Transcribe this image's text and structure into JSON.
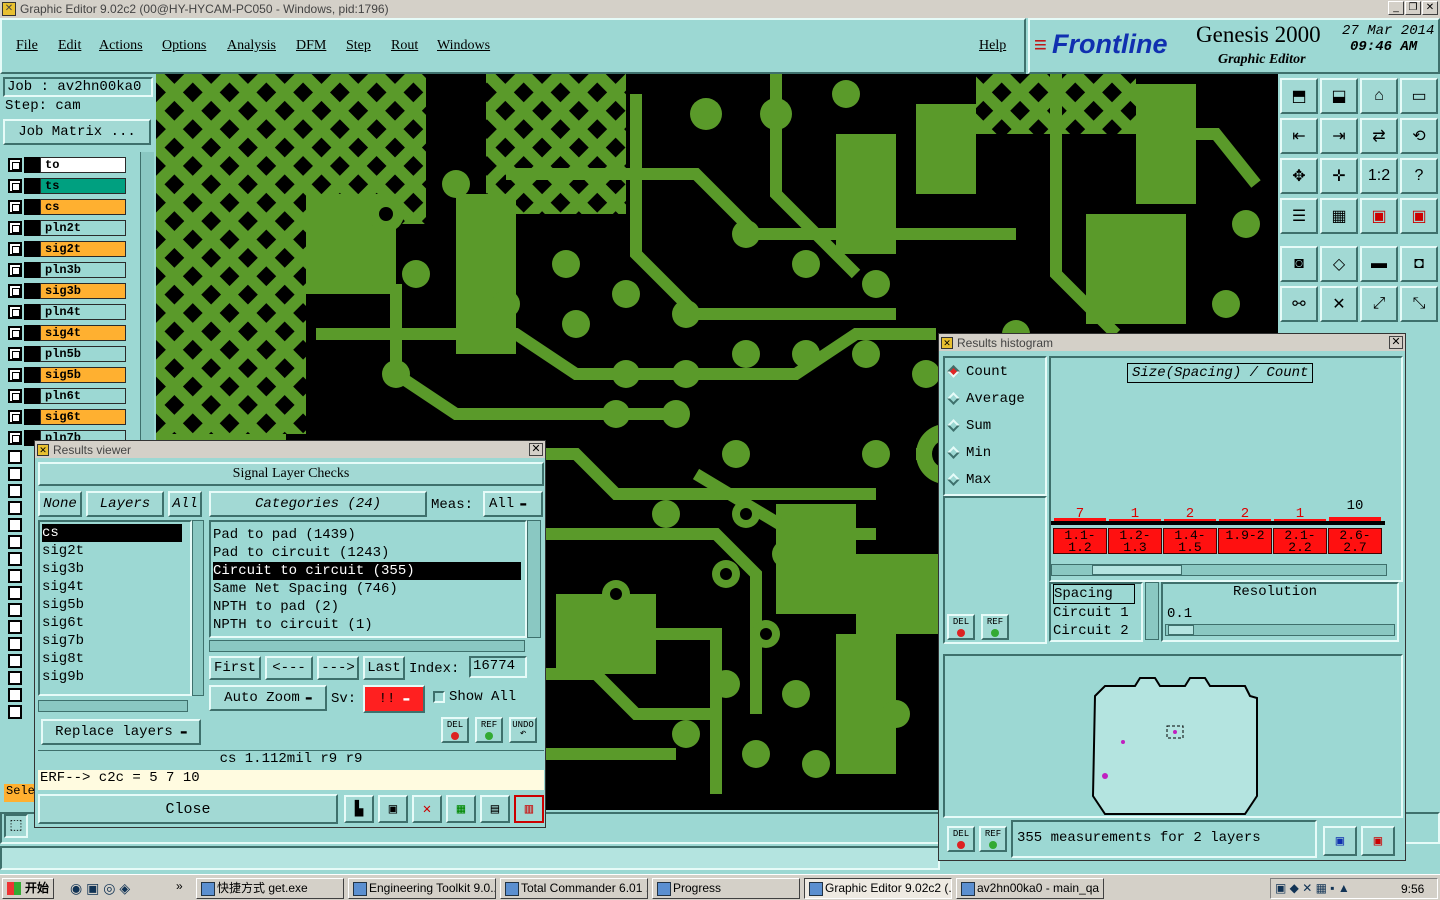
{
  "window": {
    "title": "Graphic Editor 9.02c2 (00@HY-HYCAM-PC050 - Windows, pid:1796)"
  },
  "menu": [
    "File",
    "Edit",
    "Actions",
    "Options",
    "Analysis",
    "DFM",
    "Step",
    "Rout",
    "Windows"
  ],
  "help_label": "Help",
  "brand": {
    "logo": "Frontline",
    "product": "Genesis 2000",
    "subtitle": "Graphic Editor",
    "date": "27 Mar 2014",
    "time": "09:46 AM"
  },
  "job": {
    "job_label": "Job : av2hn00ka0",
    "step_label": "Step: cam",
    "matrix_button": "Job Matrix ..."
  },
  "layers": [
    {
      "name": "to",
      "color": "#ffffff"
    },
    {
      "name": "ts",
      "color": "#00a080"
    },
    {
      "name": "cs",
      "color": "#ffb030"
    },
    {
      "name": "pln2t",
      "color": "#9cd8d3"
    },
    {
      "name": "sig2t",
      "color": "#ffb030"
    },
    {
      "name": "pln3b",
      "color": "#9cd8d3"
    },
    {
      "name": "sig3b",
      "color": "#ffb030"
    },
    {
      "name": "pln4t",
      "color": "#9cd8d3"
    },
    {
      "name": "sig4t",
      "color": "#ffb030"
    },
    {
      "name": "pln5b",
      "color": "#9cd8d3"
    },
    {
      "name": "sig5b",
      "color": "#ffb030"
    },
    {
      "name": "pln6t",
      "color": "#9cd8d3"
    },
    {
      "name": "sig6t",
      "color": "#ffb030"
    },
    {
      "name": "pln7b",
      "color": "#9cd8d3"
    }
  ],
  "sel_label": "Sele",
  "results_viewer": {
    "title": "Results viewer",
    "header": "Signal Layer Checks",
    "none_btn": "None",
    "layers_btn": "Layers",
    "all_btn": "All",
    "categories_btn": "Categories (24)",
    "meas_label": "Meas:",
    "meas_value": "All",
    "layer_list": [
      "cs",
      "sig2t",
      "sig3b",
      "sig4t",
      "sig5b",
      "sig6t",
      "sig7b",
      "sig8t",
      "sig9b"
    ],
    "categories": [
      "Pad to pad (1439)",
      "Pad to circuit (1243)",
      "Circuit to circuit (355)",
      "Same Net Spacing (746)",
      "NPTH to pad (2)",
      "NPTH to circuit (1)"
    ],
    "nav": {
      "first": "First",
      "prev": "<---",
      "next": "--->",
      "last": "Last",
      "index_label": "Index:",
      "index_value": "16774"
    },
    "auto_zoom": "Auto Zoom",
    "sv_label": "Sv:",
    "sv_value": "!!",
    "show_all": "Show All",
    "replace_layers": "Replace layers",
    "del": "DEL",
    "ref": "REF",
    "undo": "UNDO",
    "status": "cs 1.112mil  r9  r9",
    "erf_line": "ERF--> c2c = 5 7 10",
    "close": "Close"
  },
  "histogram": {
    "title": "Results histogram",
    "modes": [
      "Count",
      "Average",
      "Sum",
      "Min",
      "Max"
    ],
    "selected_mode": "Count",
    "chart_title": "Size(Spacing) / Count",
    "bins": [
      {
        "label": "1.1-1.2",
        "count": 7
      },
      {
        "label": "1.2-1.3",
        "count": 1
      },
      {
        "label": "1.4-1.5",
        "count": 2
      },
      {
        "label": "1.9-2",
        "count": 2
      },
      {
        "label": "2.1-2.2",
        "count": 1
      },
      {
        "label": "2.6-2.7",
        "count": 10
      }
    ],
    "list": [
      "Spacing",
      "Circuit 1",
      "Circuit 2"
    ],
    "resolution_label": "Resolution",
    "resolution_value": "0.1",
    "del": "DEL",
    "ref": "REF",
    "summary": "355 measurements for 2 layers"
  },
  "taskbar": {
    "start": "开始",
    "items": [
      "快捷方式 get.exe",
      "Engineering Toolkit 9.0...",
      "Total Commander 6.01 ...",
      "Progress",
      "Graphic Editor 9.02c2 (...",
      "av2hn00ka0 - main_qa"
    ],
    "clock": "9:56"
  }
}
